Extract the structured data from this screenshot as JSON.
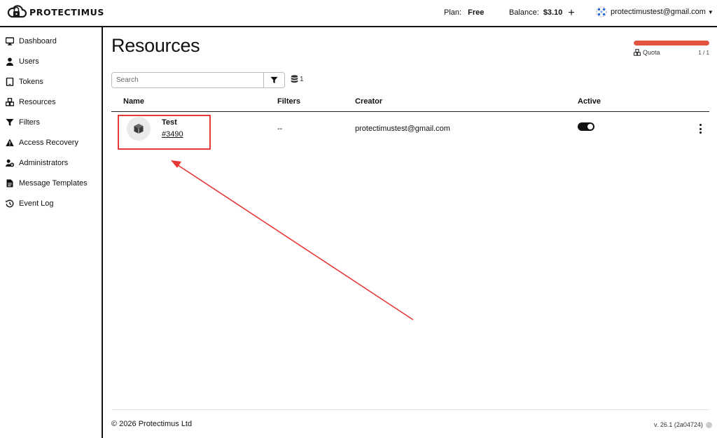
{
  "header": {
    "brand": "PROTECTIMUS",
    "plan_label": "Plan:",
    "plan_value": "Free",
    "balance_label": "Balance:",
    "balance_value": "$3.10",
    "add_symbol": "+",
    "user_email": "protectimustest@gmail.com"
  },
  "sidebar": {
    "items": [
      {
        "label": "Dashboard",
        "icon": "monitor-icon"
      },
      {
        "label": "Users",
        "icon": "user-icon"
      },
      {
        "label": "Tokens",
        "icon": "tablet-icon"
      },
      {
        "label": "Resources",
        "icon": "cubes-icon"
      },
      {
        "label": "Filters",
        "icon": "filter-icon"
      },
      {
        "label": "Access Recovery",
        "icon": "warning-icon"
      },
      {
        "label": "Administrators",
        "icon": "user-cog-icon"
      },
      {
        "label": "Message Templates",
        "icon": "file-icon"
      },
      {
        "label": "Event Log",
        "icon": "history-icon"
      }
    ]
  },
  "main": {
    "title": "Resources",
    "quota": {
      "label": "Quota",
      "count": "1 / 1",
      "fill_fraction": 1.0,
      "color": "#e2533f"
    },
    "search": {
      "placeholder": "Search",
      "value": ""
    },
    "db_count": "1",
    "table": {
      "columns": [
        "Name",
        "Filters",
        "Creator",
        "Active"
      ],
      "rows": [
        {
          "name": "Test",
          "id": "#3490",
          "filters": "--",
          "creator": "protectimustest@gmail.com",
          "active": true
        }
      ]
    }
  },
  "footer": {
    "copyright": "© 2026 Protectimus Ltd",
    "version": "v. 26.1 (2a04724)"
  },
  "colors": {
    "accent": "#e2533f",
    "annotation": "#e53935",
    "text": "#111111"
  }
}
